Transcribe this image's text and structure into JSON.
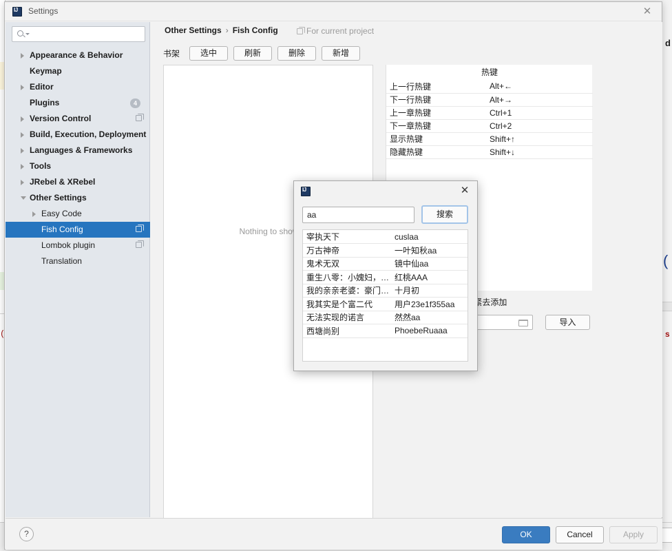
{
  "backdrop": {
    "left_code_fragment": "(",
    "right_letter_d": "d",
    "right_paren": "(",
    "right_letter_s": "s"
  },
  "window": {
    "title": "Settings",
    "logo_icon": "intellij-logo-icon",
    "close_icon": "close-icon"
  },
  "sidebar": {
    "search": {
      "value": "",
      "placeholder": "",
      "icon": "search-icon"
    },
    "items": [
      {
        "label": "Appearance & Behavior",
        "level": 0,
        "arrow": "collapsed",
        "bold": true,
        "selected": false,
        "badge": "",
        "copy": false
      },
      {
        "label": "Keymap",
        "level": 0,
        "arrow": "none",
        "bold": true,
        "selected": false,
        "badge": "",
        "copy": false
      },
      {
        "label": "Editor",
        "level": 0,
        "arrow": "collapsed",
        "bold": true,
        "selected": false,
        "badge": "",
        "copy": false
      },
      {
        "label": "Plugins",
        "level": 0,
        "arrow": "none",
        "bold": true,
        "selected": false,
        "badge": "4",
        "copy": false
      },
      {
        "label": "Version Control",
        "level": 0,
        "arrow": "collapsed",
        "bold": true,
        "selected": false,
        "badge": "",
        "copy": true
      },
      {
        "label": "Build, Execution, Deployment",
        "level": 0,
        "arrow": "collapsed",
        "bold": true,
        "selected": false,
        "badge": "",
        "copy": false
      },
      {
        "label": "Languages & Frameworks",
        "level": 0,
        "arrow": "collapsed",
        "bold": true,
        "selected": false,
        "badge": "",
        "copy": false
      },
      {
        "label": "Tools",
        "level": 0,
        "arrow": "collapsed",
        "bold": true,
        "selected": false,
        "badge": "",
        "copy": false
      },
      {
        "label": "JRebel & XRebel",
        "level": 0,
        "arrow": "collapsed",
        "bold": true,
        "selected": false,
        "badge": "",
        "copy": false
      },
      {
        "label": "Other Settings",
        "level": 0,
        "arrow": "expanded",
        "bold": true,
        "selected": false,
        "badge": "",
        "copy": false
      },
      {
        "label": "Easy Code",
        "level": 1,
        "arrow": "collapsed",
        "bold": false,
        "selected": false,
        "badge": "",
        "copy": false
      },
      {
        "label": "Fish Config",
        "level": 1,
        "arrow": "none",
        "bold": false,
        "selected": true,
        "badge": "",
        "copy": true
      },
      {
        "label": "Lombok plugin",
        "level": 1,
        "arrow": "none",
        "bold": false,
        "selected": false,
        "badge": "",
        "copy": true
      },
      {
        "label": "Translation",
        "level": 1,
        "arrow": "none",
        "bold": false,
        "selected": false,
        "badge": "",
        "copy": false
      }
    ]
  },
  "main": {
    "breadcrumb": {
      "parent": "Other Settings",
      "separator": "›",
      "current": "Fish Config"
    },
    "scope_note": {
      "text": "For current project",
      "icon": "copy-icon"
    },
    "toolbar": {
      "shelf_label": "书架",
      "buttons": [
        {
          "label": "选中",
          "name": "select-button"
        },
        {
          "label": "刷新",
          "name": "refresh-button"
        },
        {
          "label": "删除",
          "name": "delete-button"
        },
        {
          "label": "新增",
          "name": "add-button"
        }
      ]
    },
    "shelf_empty_text": "Nothing to show",
    "hotkeys": {
      "title": "热键",
      "rows": [
        {
          "name": "上一行热键",
          "key": "Alt+←"
        },
        {
          "name": "下一行热键",
          "key": "Alt+→"
        },
        {
          "name": "上一章热键",
          "key": "Ctrl+1"
        },
        {
          "name": "下一章热键",
          "key": "Ctrl+2"
        },
        {
          "name": "显示热键",
          "key": "Shift+↑"
        },
        {
          "name": "隐藏热键",
          "key": "Shift+↓"
        }
      ]
    },
    "shelf_hint": "有书,赶紧去添加",
    "import": {
      "path_value": "",
      "folder_icon": "folder-icon",
      "button_label": "导入"
    }
  },
  "dialog": {
    "logo_icon": "intellij-logo-icon",
    "close_icon": "close-icon",
    "keyword_value": "aa",
    "keyword_placeholder": "",
    "search_button_label": "搜索",
    "results": [
      {
        "title": "宰执天下",
        "author": "cuslaa"
      },
      {
        "title": "万古神帝",
        "author": "一叶知秋aa"
      },
      {
        "title": "鬼术无双",
        "author": "镜中仙aa"
      },
      {
        "title": "重生八零：小媿妇，…",
        "author": "红桃AAA"
      },
      {
        "title": "我的亲亲老婆：豪门…",
        "author": "十月初"
      },
      {
        "title": "我其实是个富二代",
        "author": "用户23e1f355aa"
      },
      {
        "title": "无法实现的诺言",
        "author": "然然aa"
      },
      {
        "title": "西塘尚别",
        "author": "PhoebeRuaaa"
      }
    ]
  },
  "bottombar": {
    "help_label": "?",
    "ok_label": "OK",
    "cancel_label": "Cancel",
    "apply_label": "Apply"
  },
  "colors": {
    "accent": "#2675bf",
    "ok_button": "#3a7cc0",
    "sidebar_bg": "#e3e7ec",
    "panel_bg": "#f2f2f2"
  }
}
